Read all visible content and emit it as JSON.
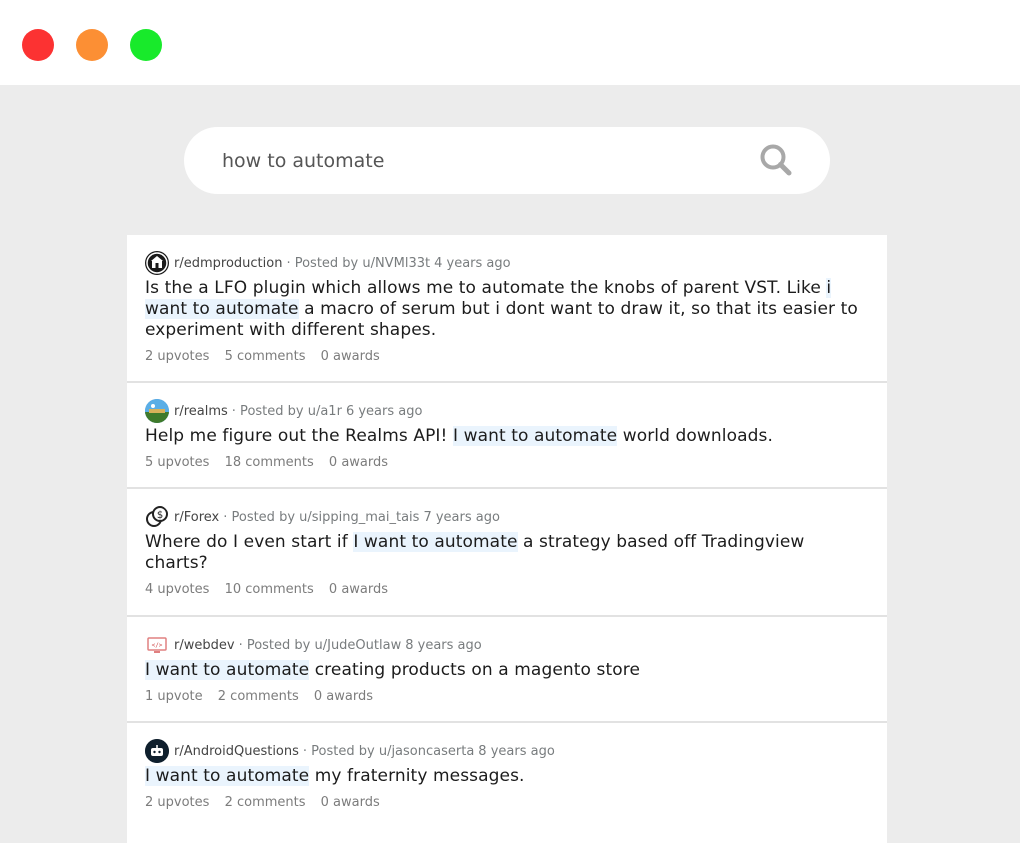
{
  "window": {
    "controls": [
      "close",
      "minimize",
      "maximize"
    ]
  },
  "search": {
    "query": "how to automate",
    "icon": "search-icon"
  },
  "colors": {
    "close": "#fc3232",
    "minimize": "#fc8f34",
    "maximize": "#18ea2b",
    "highlight": "#eaf4fd"
  },
  "results": [
    {
      "subreddit": "r/edmproduction",
      "posted_by": "· Posted by u/NVMl33t",
      "age": "4 years ago",
      "title_before": "Is the a LFO plugin which allows me to automate the knobs of parent VST. Like ",
      "title_highlight": "i want to automate",
      "title_after": " a macro of serum but i dont want to draw it, so that its easier to experiment with different shapes.",
      "upvotes": "2 upvotes",
      "comments": "5 comments",
      "awards": "0 awards"
    },
    {
      "subreddit": "r/realms",
      "posted_by": "· Posted by u/a1r",
      "age": "6 years ago",
      "title_before": "Help me figure out the Realms API! ",
      "title_highlight": "I want to automate",
      "title_after": " world downloads.",
      "upvotes": "5 upvotes",
      "comments": "18 comments",
      "awards": "0 awards"
    },
    {
      "subreddit": "r/Forex",
      "posted_by": "· Posted by u/sipping_mai_tais",
      "age": "7 years ago",
      "title_before": "Where do I even start if ",
      "title_highlight": "I want to automate",
      "title_after": " a strategy based off Tradingview charts?",
      "upvotes": "4 upvotes",
      "comments": "10 comments",
      "awards": "0 awards"
    },
    {
      "subreddit": "r/webdev",
      "posted_by": "· Posted by u/JudeOutlaw",
      "age": "8 years ago",
      "title_before": "",
      "title_highlight": "I want to automate",
      "title_after": " creating products on a magento store",
      "upvotes": "1 upvote",
      "comments": "2 comments",
      "awards": "0 awards"
    },
    {
      "subreddit": "r/AndroidQuestions",
      "posted_by": "· Posted by u/jasoncaserta",
      "age": "8 years ago",
      "title_before": "",
      "title_highlight": "I want to automate",
      "title_after": " my fraternity messages.",
      "upvotes": "2 upvotes",
      "comments": "2 comments",
      "awards": "0 awards"
    }
  ]
}
